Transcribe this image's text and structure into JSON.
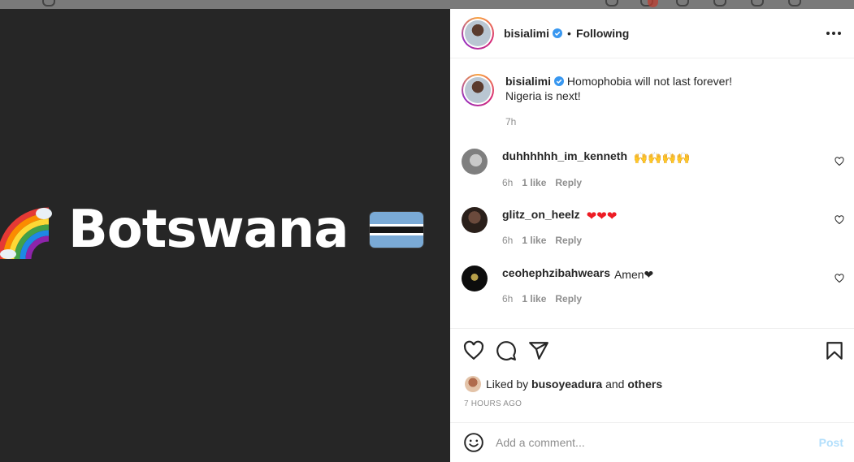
{
  "post": {
    "author": "bisialimi",
    "follow_status": "Following",
    "separator": "•"
  },
  "media": {
    "word": "Botswana",
    "flag_colors": [
      "#75aadb",
      "#ffffff",
      "#000000"
    ]
  },
  "caption": {
    "author": "bisialimi",
    "line1": "Homophobia will not last forever!",
    "line2": "Nigeria is next!",
    "time": "7h"
  },
  "comments": [
    {
      "user": "duhhhhhh_im_kenneth",
      "text": "🙌🙌🙌🙌",
      "time": "6h",
      "likes": "1 like",
      "reply": "Reply"
    },
    {
      "user": "glitz_on_heelz",
      "text": "❤❤❤",
      "time": "6h",
      "likes": "1 like",
      "reply": "Reply"
    },
    {
      "user": "ceohephzibahwears",
      "text": "Amen❤",
      "time": "6h",
      "likes": "1 like",
      "reply": "Reply"
    }
  ],
  "likes": {
    "prefix": "Liked by",
    "user": "busoyeadura",
    "middle": "and",
    "others": "others"
  },
  "timestamp": "7 HOURS AGO",
  "add_comment": {
    "placeholder": "Add a comment...",
    "post_label": "Post"
  },
  "colors": {
    "verified": "#3897f0",
    "post_disabled": "#b2dffc",
    "heart": "#ed1c24",
    "media_bg": "#262626"
  },
  "icons": [
    "heart-icon",
    "comment-icon",
    "share-icon",
    "bookmark-icon",
    "emoji-icon",
    "more-options-icon",
    "verified-badge-icon"
  ]
}
